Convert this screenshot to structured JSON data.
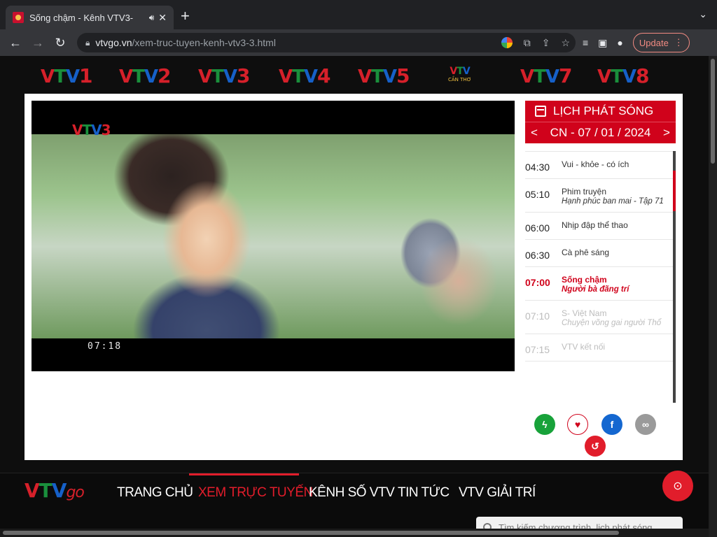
{
  "browser": {
    "tab_title": "Sống chậm - Kênh VTV3-",
    "speaker_icon": "speaker-icon",
    "new_tab": "+",
    "url_domain": "vtvgo.vn",
    "url_path": "/xem-truc-tuyen-kenh-vtv3-3.html",
    "update_label": "Update"
  },
  "channels": [
    {
      "prefix": "VT",
      "suffix": "V",
      "num": "1"
    },
    {
      "prefix": "VT",
      "suffix": "V",
      "num": "2"
    },
    {
      "prefix": "VT",
      "suffix": "V",
      "num": "3"
    },
    {
      "prefix": "VT",
      "suffix": "V",
      "num": "4"
    },
    {
      "prefix": "VT",
      "suffix": "V",
      "num": "5"
    },
    {
      "prefix": "VT",
      "suffix": "V",
      "num": "CẦN THƠ"
    },
    {
      "prefix": "VT",
      "suffix": "V",
      "num": "7"
    },
    {
      "prefix": "VT",
      "suffix": "V",
      "num": "8"
    }
  ],
  "player": {
    "channel_logo": "VTV3",
    "clock": "07:18"
  },
  "schedule": {
    "title": "LỊCH PHÁT SÓNG",
    "prev": "<",
    "date": "CN - 07 / 01 / 2024",
    "next": ">",
    "items": [
      {
        "time": "04:30",
        "program": "Vui - khỏe - có ích",
        "episode": ""
      },
      {
        "time": "05:10",
        "program": "Phim truyện",
        "episode": "Hạnh phúc ban mai - Tập 71"
      },
      {
        "time": "06:00",
        "program": "Nhịp đập thể thao",
        "episode": ""
      },
      {
        "time": "06:30",
        "program": "Cà phê sáng",
        "episode": ""
      },
      {
        "time": "07:00",
        "program": "Sống chậm",
        "episode": "Người bà đãng trí"
      },
      {
        "time": "07:10",
        "program": "S- Việt Nam",
        "episode": "Chuyện võng gai người Thổ"
      },
      {
        "time": "07:15",
        "program": "VTV kết nối",
        "episode": ""
      }
    ]
  },
  "nav": {
    "brand": "VTV",
    "brand_go": "go",
    "items": [
      "TRANG CHỦ",
      "XEM TRỰC TUYẾN",
      "KÊNH SỐ VTV",
      "TIN TỨC",
      "VTV GIẢI TRÍ"
    ],
    "search_placeholder": "Tìm kiếm chương trình, lịch phát sóng"
  },
  "colors": {
    "accent": "#d0021b",
    "vtv_green": "#1a8f3c",
    "vtv_blue": "#1660c8"
  }
}
